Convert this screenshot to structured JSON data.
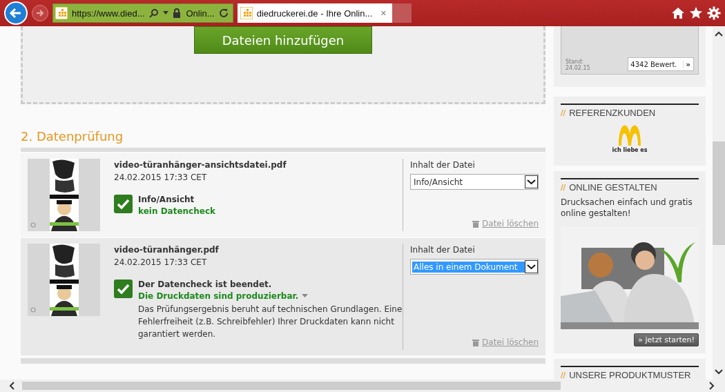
{
  "browser": {
    "back_enabled": true,
    "forward_enabled": false,
    "address": "https://www.died...",
    "site_label": "Onlin...",
    "tab_title": "diedruckerei.de - Ihre Onlin...",
    "tab_close": "×"
  },
  "upload": {
    "button": "Dateien hinzufügen"
  },
  "section_title": "2. Datenprüfung",
  "files": [
    {
      "name": "video-türanhänger-ansichtsdatei.pdf",
      "date": "24.02.2015 17:33 CET",
      "checked": true,
      "status_title": "Info/Ansicht",
      "status_detail": "kein Datencheck",
      "has_dropdown": false,
      "content_label": "Inhalt der Datei",
      "content_value": "Info/Ansicht",
      "value_highlighted": false,
      "delete": "Datei löschen"
    },
    {
      "name": "video-türanhänger.pdf",
      "date": "24.02.2015 17:33 CET",
      "checked": true,
      "status_title": "Der Datencheck ist beendet.",
      "status_detail": "Die Druckdaten sind produzierbar.",
      "has_dropdown": true,
      "note": "Das Prüfungsergebnis beruht auf technischen Grundlagen. Eine Fehlerfreiheit (z.B. Schreibfehler) Ihrer Druckdaten kann nicht garantiert werden.",
      "content_label": "Inhalt der Datei",
      "content_value": "Alles in einem Dokument",
      "value_highlighted": true,
      "delete": "Datei löschen"
    }
  ],
  "sidebar": {
    "rating": {
      "stand_label": "Stand:",
      "stand_date": "24.02.15",
      "count": "4342 Bewert.",
      "more": "»"
    },
    "cards": [
      {
        "kind": "logo",
        "prefix": "//",
        "title": "REFERENZKUNDEN",
        "slogan": "ich liebe es"
      },
      {
        "kind": "promo",
        "prefix": "//",
        "title": "ONLINE GESTALTEN",
        "text": "Drucksachen einfach und gratis online gestalten!",
        "button": "» jetzt starten!"
      },
      {
        "kind": "plain",
        "prefix": "//",
        "title": "UNSERE PRODUKTMUSTER"
      }
    ]
  }
}
